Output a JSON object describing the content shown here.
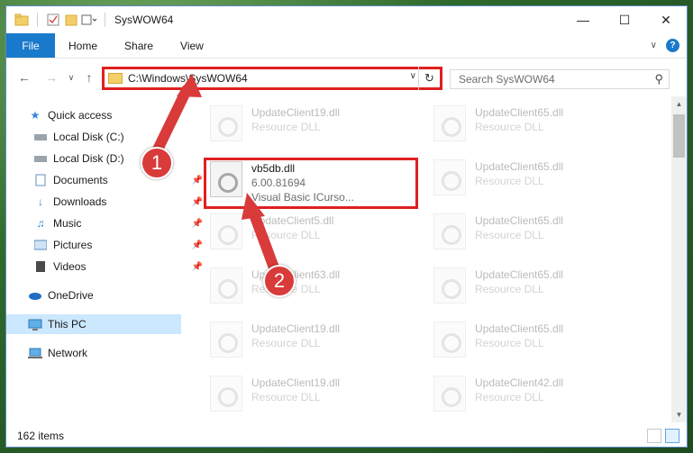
{
  "window": {
    "title": "SysWOW64"
  },
  "ribbon": {
    "tabs": [
      "File",
      "Home",
      "Share",
      "View"
    ]
  },
  "address": {
    "path": "C:\\Windows\\SysWOW64",
    "search_placeholder": "Search SysWOW64"
  },
  "sidebar": {
    "items": [
      {
        "label": "Quick access",
        "icon": "star-icon"
      },
      {
        "label": "Local Disk (C:)",
        "icon": "drive-icon"
      },
      {
        "label": "Local Disk (D:)",
        "icon": "drive-icon"
      },
      {
        "label": "Documents",
        "icon": "documents-icon"
      },
      {
        "label": "Downloads",
        "icon": "download-icon"
      },
      {
        "label": "Music",
        "icon": "music-icon"
      },
      {
        "label": "Pictures",
        "icon": "pictures-icon"
      },
      {
        "label": "Videos",
        "icon": "videos-icon"
      },
      {
        "label": "OneDrive",
        "icon": "cloud-icon"
      },
      {
        "label": "This PC",
        "icon": "computer-icon"
      },
      {
        "label": "Network",
        "icon": "network-icon"
      }
    ]
  },
  "files": {
    "left": [
      {
        "name": "UpdateClient19.dll",
        "sub": "Resource DLL"
      },
      {
        "name": "vb5db.dll",
        "version": "6.00.81694",
        "desc": "Visual Basic ICurso..."
      },
      {
        "name": "UpdateClient5.dll",
        "sub": "Resource DLL"
      },
      {
        "name": "UpdateClient63.dll",
        "sub": "Resource DLL"
      },
      {
        "name": "UpdateClient19.dll",
        "sub": "Resource DLL"
      },
      {
        "name": "UpdateClient19.dll",
        "sub": "Resource DLL"
      }
    ],
    "right": [
      {
        "name": "UpdateClient65.dll",
        "sub": "Resource DLL"
      },
      {
        "name": "UpdateClient65.dll",
        "sub": "Resource DLL"
      },
      {
        "name": "UpdateClient65.dll",
        "sub": "Resource DLL"
      },
      {
        "name": "UpdateClient65.dll",
        "sub": "Resource DLL"
      },
      {
        "name": "UpdateClient65.dll",
        "sub": "Resource DLL"
      },
      {
        "name": "UpdateClient42.dll",
        "sub": "Resource DLL"
      }
    ]
  },
  "status": {
    "count": "162 items"
  },
  "annotations": {
    "step1": "1",
    "step2": "2",
    "color": "#d93a3a"
  }
}
